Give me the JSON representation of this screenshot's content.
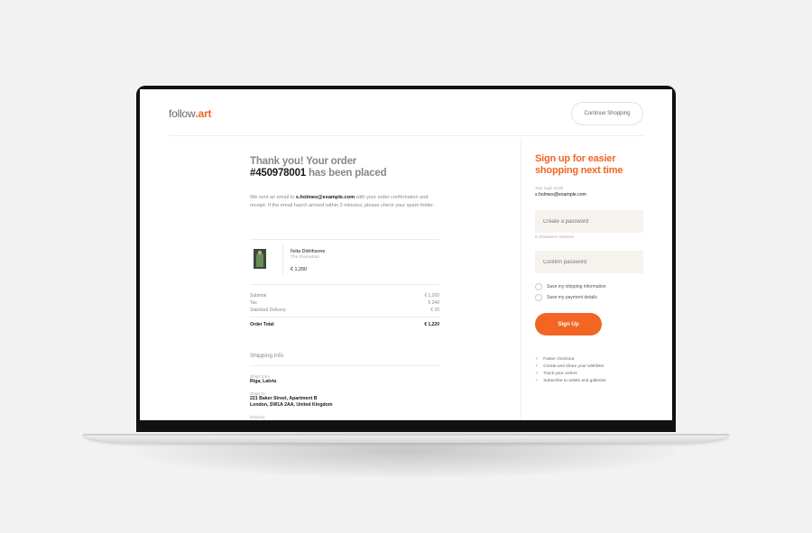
{
  "header": {
    "logo_prefix": "follow",
    "logo_suffix": ".art",
    "continue_label": "Continue Shopping"
  },
  "order": {
    "title_line1": "Thank you! Your order",
    "order_number": "#450978001",
    "title_rest": " has been placed",
    "intro_pre": "We sent an email to ",
    "email": "s.holmes@example.com",
    "intro_post": " with your order confirmation and receipt. If the email hasn't arrived within 2 minutes, please check your spam folder."
  },
  "item": {
    "artist": "Ilvita Didrihsone",
    "title": "The Overadder",
    "price": "€ 1,200"
  },
  "summary": [
    {
      "label": "Subtotal",
      "value": "€ 1,200"
    },
    {
      "label": "Tax",
      "value": "€ 240"
    },
    {
      "label": "Standard Delivery",
      "value": "€ 20"
    }
  ],
  "total": {
    "label": "Order Total",
    "value": "€ 1,220"
  },
  "shipping": {
    "title": "Shipping Info",
    "from_label": "Ships from",
    "from_value": "Riga, Latvia",
    "to_label": "Ships to",
    "to_line1": "221 Baker Street, Apartment B",
    "to_line2": "London, SW1A 2AA, United Kingdom",
    "delivery_label": "Delivery"
  },
  "signup": {
    "title_line1": "Sign up for easier",
    "title_line2": "shopping next time",
    "email_label": "Your login email",
    "email_value": "s.holmes@example.com",
    "password_placeholder": "Create a password",
    "password_hint": "8 characters minimum",
    "confirm_placeholder": "Confirm password",
    "check_shipping": "Save my shipping information",
    "check_payment": "Save my payment details",
    "button": "Sign Up",
    "perks": [
      "Faster checkout",
      "Create and share your wishlists",
      "Track your orders",
      "Subscribe to artists and galleries"
    ]
  },
  "colors": {
    "accent": "#f26522"
  }
}
